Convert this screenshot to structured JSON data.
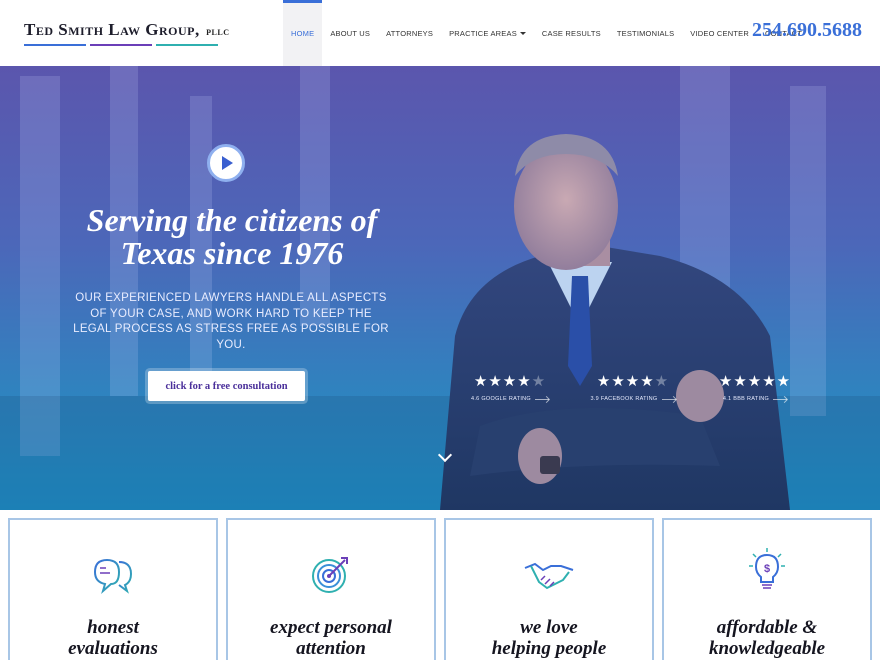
{
  "header": {
    "logo": {
      "name": "Ted Smith Law Group,",
      "suffix": "PLLC"
    },
    "nav": [
      {
        "label": "Home",
        "active": true
      },
      {
        "label": "About Us"
      },
      {
        "label": "Attorneys"
      },
      {
        "label": "Practice Areas",
        "dropdown": true
      },
      {
        "label": "Case Results"
      },
      {
        "label": "Testimonials"
      },
      {
        "label": "Video Center"
      },
      {
        "label": "Contact"
      }
    ],
    "phone": "254.690.5688"
  },
  "hero": {
    "headline": "Serving the citizens of Texas since 1976",
    "subtext": "Our experienced lawyers handle all aspects of your case, and work hard to keep the legal process as stress free as possible for you.",
    "cta": "click for a free consultation",
    "ratings": [
      {
        "label": "4.6 Google Rating",
        "score": 4.6,
        "stars": "★★★★",
        "half": "★"
      },
      {
        "label": "3.9 Facebook Rating",
        "score": 3.9,
        "stars": "★★★★",
        "half": "★"
      },
      {
        "label": "4.1 BBB Rating",
        "score": 4.1,
        "stars": "★★★★★",
        "half": ""
      }
    ]
  },
  "features": [
    {
      "title": "honest\nevaluations",
      "icon": "speech-bubbles-icon"
    },
    {
      "title": "expect personal\nattention",
      "icon": "target-icon"
    },
    {
      "title": "we love\nhelping people",
      "icon": "handshake-icon"
    },
    {
      "title": "affordable &\nknowledgeable",
      "icon": "lightbulb-dollar-icon"
    }
  ],
  "colors": {
    "accent": "#3a6fd8",
    "logo_bar_1": "#3a6fd8",
    "logo_bar_2": "#6b3fb8",
    "logo_bar_3": "#2fb0b0",
    "card_border": "#a8c6e6"
  }
}
